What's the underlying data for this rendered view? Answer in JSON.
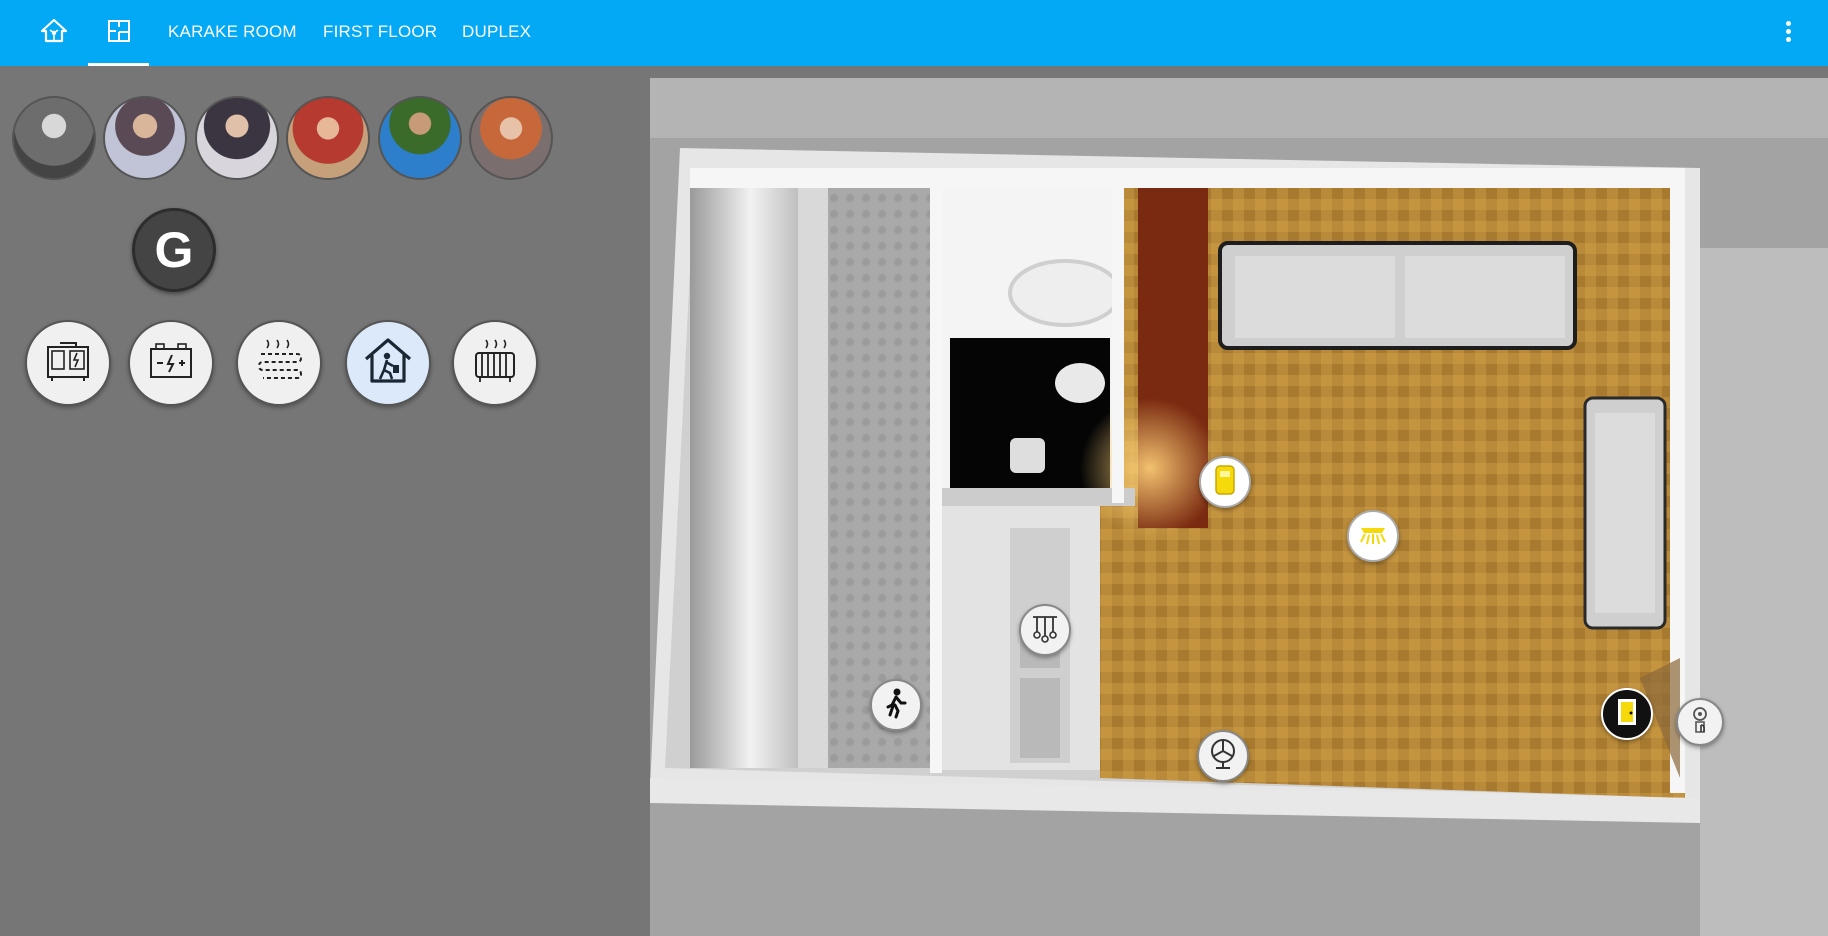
{
  "header": {
    "tabs": [
      {
        "icon": "home-assistant-icon"
      },
      {
        "icon": "floorplan-icon",
        "active": true
      },
      {
        "label": "KARAKE ROOM"
      },
      {
        "label": "FIRST FLOOR"
      },
      {
        "label": "DUPLEX"
      }
    ],
    "menu_icon": "dots-vertical-icon",
    "color": "#03a9f4"
  },
  "people": {
    "avatars": [
      "person-1",
      "person-2",
      "person-3",
      "person-4",
      "person-5",
      "person-6"
    ]
  },
  "badge": {
    "letter": "G"
  },
  "devices": [
    {
      "icon": "generator-icon"
    },
    {
      "icon": "battery-icon"
    },
    {
      "icon": "floor-heating-icon"
    },
    {
      "icon": "home-away-icon",
      "active": true
    },
    {
      "icon": "radiator-icon"
    }
  ],
  "floorplan": {
    "markers": [
      {
        "icon": "water-heater-icon",
        "state": "on",
        "color": "#f5d90a"
      },
      {
        "icon": "ceiling-light-icon",
        "state": "on",
        "color": "#f5d90a"
      },
      {
        "icon": "chandelier-icon",
        "state": "off"
      },
      {
        "icon": "motion-sensor-icon",
        "state": "off"
      },
      {
        "icon": "fan-icon",
        "state": "off"
      },
      {
        "icon": "door-icon",
        "state": "on",
        "color": "#f5d90a"
      },
      {
        "icon": "doorbell-camera-icon",
        "state": "off"
      }
    ]
  }
}
